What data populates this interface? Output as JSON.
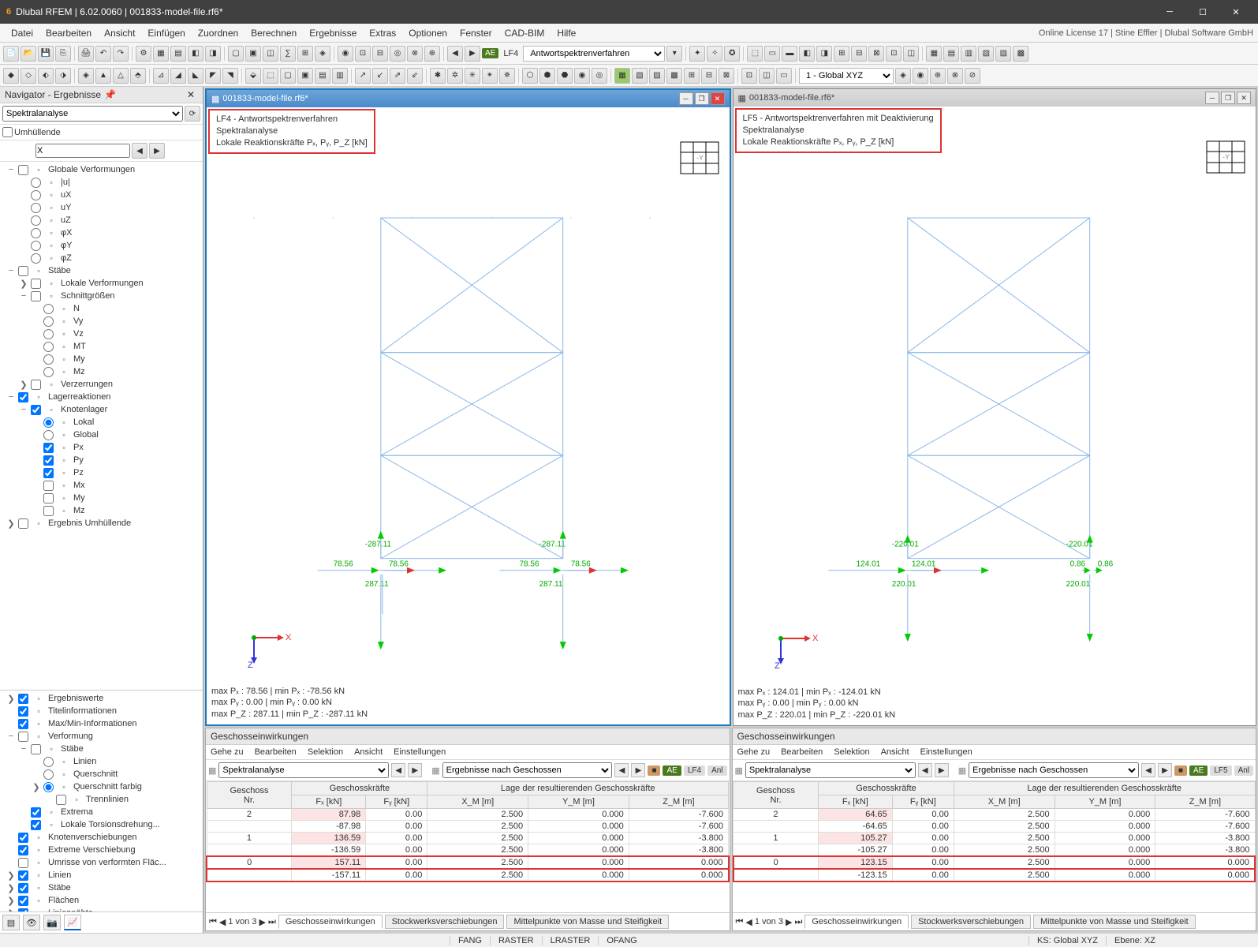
{
  "app": {
    "title": "Dlubal RFEM | 6.02.0060 | 001833-model-file.rf6*",
    "license": "Online License 17 | Stine Effler | Dlubal Software GmbH"
  },
  "menus": [
    "Datei",
    "Bearbeiten",
    "Ansicht",
    "Einfügen",
    "Zuordnen",
    "Berechnen",
    "Ergebnisse",
    "Extras",
    "Optionen",
    "Fenster",
    "CAD-BIM",
    "Hilfe"
  ],
  "toolbar": {
    "badge": "AE",
    "lf_label": "LF4",
    "lf_select": "Antwortspektrenverfahren",
    "coord_select": "1 - Global XYZ"
  },
  "navigator": {
    "title": "Navigator - Ergebnisse",
    "select": "Spektralanalyse",
    "umhullende": "Umhüllende",
    "x_value": "X",
    "tree": [
      {
        "d": 0,
        "e": "−",
        "chk": false,
        "icon": "",
        "t": "Globale Verformungen"
      },
      {
        "d": 1,
        "r": true,
        "rs": false,
        "t": "|u|"
      },
      {
        "d": 1,
        "r": true,
        "rs": false,
        "t": "uX"
      },
      {
        "d": 1,
        "r": true,
        "rs": false,
        "t": "uY"
      },
      {
        "d": 1,
        "r": true,
        "rs": false,
        "t": "uZ"
      },
      {
        "d": 1,
        "r": true,
        "rs": false,
        "t": "φX"
      },
      {
        "d": 1,
        "r": true,
        "rs": false,
        "t": "φY"
      },
      {
        "d": 1,
        "r": true,
        "rs": false,
        "t": "φZ"
      },
      {
        "d": 0,
        "e": "−",
        "chk": false,
        "icon": "stab",
        "t": "Stäbe"
      },
      {
        "d": 1,
        "e": "❯",
        "chk": false,
        "t": "Lokale Verformungen"
      },
      {
        "d": 1,
        "e": "−",
        "chk": false,
        "t": "Schnittgrößen"
      },
      {
        "d": 2,
        "r": true,
        "rs": false,
        "t": "N"
      },
      {
        "d": 2,
        "r": true,
        "rs": false,
        "t": "Vy"
      },
      {
        "d": 2,
        "r": true,
        "rs": false,
        "t": "Vz"
      },
      {
        "d": 2,
        "r": true,
        "rs": false,
        "t": "MT"
      },
      {
        "d": 2,
        "r": true,
        "rs": false,
        "t": "My"
      },
      {
        "d": 2,
        "r": true,
        "rs": false,
        "t": "Mz"
      },
      {
        "d": 1,
        "e": "❯",
        "chk": false,
        "t": "Verzerrungen"
      },
      {
        "d": 0,
        "e": "−",
        "chk": true,
        "t": "Lagerreaktionen"
      },
      {
        "d": 1,
        "e": "−",
        "chk": true,
        "t": "Knotenlager"
      },
      {
        "d": 2,
        "r": true,
        "rs": true,
        "t": "Lokal"
      },
      {
        "d": 2,
        "r": true,
        "rs": false,
        "t": "Global"
      },
      {
        "d": 2,
        "chk": true,
        "t": "Px"
      },
      {
        "d": 2,
        "chk": true,
        "t": "Py"
      },
      {
        "d": 2,
        "chk": true,
        "t": "Pz"
      },
      {
        "d": 2,
        "chk": false,
        "t": "Mx"
      },
      {
        "d": 2,
        "chk": false,
        "t": "My"
      },
      {
        "d": 2,
        "chk": false,
        "t": "Mz"
      },
      {
        "d": 0,
        "e": "❯",
        "chk": false,
        "t": "Ergebnis Umhüllende"
      }
    ],
    "tree2": [
      {
        "d": 0,
        "e": "❯",
        "chk": true,
        "t": "Ergebniswerte"
      },
      {
        "d": 0,
        "chk": true,
        "t": "Titelinformationen"
      },
      {
        "d": 0,
        "chk": true,
        "t": "Max/Min-Informationen"
      },
      {
        "d": 0,
        "e": "−",
        "chk": false,
        "t": "Verformung"
      },
      {
        "d": 1,
        "e": "−",
        "chk": false,
        "t": "Stäbe"
      },
      {
        "d": 2,
        "r": true,
        "rs": false,
        "t": "Linien"
      },
      {
        "d": 2,
        "r": true,
        "rs": false,
        "t": "Querschnitt"
      },
      {
        "d": 2,
        "e": "❯",
        "r": true,
        "rs": true,
        "t": "Querschnitt farbig"
      },
      {
        "d": 3,
        "chk": false,
        "t": "Trennlinien"
      },
      {
        "d": 1,
        "chk": true,
        "t": "Extrema"
      },
      {
        "d": 1,
        "chk": true,
        "t": "Lokale Torsionsdrehung..."
      },
      {
        "d": 0,
        "chk": true,
        "t": "Knotenverschiebungen"
      },
      {
        "d": 0,
        "chk": true,
        "t": "Extreme Verschiebung"
      },
      {
        "d": 0,
        "chk": false,
        "t": "Umrisse von verformten Fläc..."
      },
      {
        "d": 0,
        "e": "❯",
        "chk": true,
        "t": "Linien"
      },
      {
        "d": 0,
        "e": "❯",
        "chk": true,
        "t": "Stäbe"
      },
      {
        "d": 0,
        "e": "❯",
        "chk": true,
        "t": "Flächen"
      },
      {
        "d": 0,
        "e": "❯",
        "chk": true,
        "t": "Liniennähte"
      }
    ]
  },
  "views": [
    {
      "file": "001833-model-file.rf6*",
      "box_l1": "LF4 - Antwortspektrenverfahren",
      "box_l2": "Spektralanalyse",
      "box_l3": "Lokale Reaktionskräfte Pₓ, Pᵧ, P_Z [kN]",
      "values": {
        "top": "-287.11",
        "side": "78.56",
        "bottom": "287.11"
      },
      "summary": [
        "max Pₓ : 78.56 | min Pₓ : -78.56 kN",
        "max Pᵧ : 0.00 | min Pᵧ : 0.00 kN",
        "max P_Z : 287.11 | min P_Z : -287.11 kN"
      ]
    },
    {
      "file": "001833-model-file.rf6*",
      "box_l1": "LF5 - Antwortspektrenverfahren mit Deaktivierung",
      "box_l2": "Spektralanalyse",
      "box_l3": "Lokale Reaktionskräfte Pₓ, Pᵧ, P_Z [kN]",
      "values": {
        "top": "-220.01",
        "side_l": "124.01",
        "side_r": "0.86",
        "bottom": "220.01"
      },
      "summary": [
        "max Pₓ : 124.01 | min Pₓ : -124.01 kN",
        "max Pᵧ : 0.00 | min Pᵧ : 0.00 kN",
        "max P_Z : 220.01 | min P_Z : -220.01 kN"
      ]
    }
  ],
  "tables": {
    "title": "Geschosseinwirkungen",
    "menus": [
      "Gehe zu",
      "Bearbeiten",
      "Selektion",
      "Ansicht",
      "Einstellungen"
    ],
    "sel_left": "Spektralanalyse",
    "sel_right": "Ergebnisse nach Geschossen",
    "lf4": "LF4",
    "lf5": "LF5",
    "anl": "Anl",
    "headers": {
      "g1": "Geschoss",
      "g1s": "Nr.",
      "g2": "Geschosskräfte",
      "g2a": "Fₓ [kN]",
      "g2b": "Fᵧ [kN]",
      "g3": "Lage der resultierenden Geschosskräfte",
      "g3a": "X_M [m]",
      "g3b": "Y_M [m]",
      "g3c": "Z_M [m]"
    },
    "left_rows": [
      {
        "n": "2",
        "fx": "87.98",
        "fy": "0.00",
        "xm": "2.500",
        "ym": "0.000",
        "zm": "-7.600"
      },
      {
        "n": "",
        "fx": "-87.98",
        "fy": "0.00",
        "xm": "2.500",
        "ym": "0.000",
        "zm": "-7.600"
      },
      {
        "n": "1",
        "fx": "136.59",
        "fy": "0.00",
        "xm": "2.500",
        "ym": "0.000",
        "zm": "-3.800"
      },
      {
        "n": "",
        "fx": "-136.59",
        "fy": "0.00",
        "xm": "2.500",
        "ym": "0.000",
        "zm": "-3.800"
      },
      {
        "n": "0",
        "fx": "157.11",
        "fy": "0.00",
        "xm": "2.500",
        "ym": "0.000",
        "zm": "0.000",
        "hl": true
      },
      {
        "n": "",
        "fx": "-157.11",
        "fy": "0.00",
        "xm": "2.500",
        "ym": "0.000",
        "zm": "0.000",
        "hl": true
      }
    ],
    "right_rows": [
      {
        "n": "2",
        "fx": "64.65",
        "fy": "0.00",
        "xm": "2.500",
        "ym": "0.000",
        "zm": "-7.600"
      },
      {
        "n": "",
        "fx": "-64.65",
        "fy": "0.00",
        "xm": "2.500",
        "ym": "0.000",
        "zm": "-7.600"
      },
      {
        "n": "1",
        "fx": "105.27",
        "fy": "0.00",
        "xm": "2.500",
        "ym": "0.000",
        "zm": "-3.800"
      },
      {
        "n": "",
        "fx": "-105.27",
        "fy": "0.00",
        "xm": "2.500",
        "ym": "0.000",
        "zm": "-3.800"
      },
      {
        "n": "0",
        "fx": "123.15",
        "fy": "0.00",
        "xm": "2.500",
        "ym": "0.000",
        "zm": "0.000",
        "hl": true
      },
      {
        "n": "",
        "fx": "-123.15",
        "fy": "0.00",
        "xm": "2.500",
        "ym": "0.000",
        "zm": "0.000",
        "hl": true
      }
    ],
    "paging": "1 von 3",
    "tabs": [
      "Geschosseinwirkungen",
      "Stockwerksverschiebungen",
      "Mittelpunkte von Masse und Steifigkeit"
    ]
  },
  "status": {
    "fang": "FANG",
    "raster": "RASTER",
    "lraster": "LRASTER",
    "ofang": "OFANG",
    "ks": "KS: Global XYZ",
    "ebene": "Ebene: XZ"
  }
}
